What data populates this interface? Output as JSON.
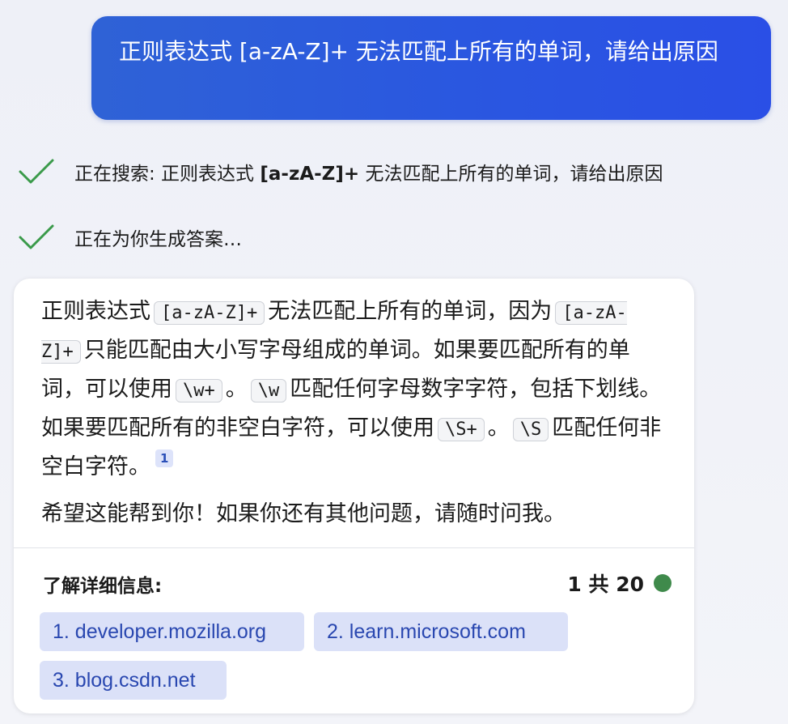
{
  "user_message": "正则表达式 [a-zA-Z]+ 无法匹配上所有的单词，请给出原因",
  "status": {
    "search_prefix": "正在搜索: 正则表达式 ",
    "search_bold": "[a-zA-Z]+",
    "search_suffix": " 无法匹配上所有的单词，请给出原因",
    "generating": "正在为你生成答案…"
  },
  "answer": {
    "t1": "正则表达式",
    "c1": "[a-zA-Z]+",
    "t2": "无法匹配上所有的单词，因为",
    "c2": "[a-zA-Z]+",
    "t3": "只能匹配由大小写字母组成的单词。如果要匹配所有的单词，可以使用",
    "c3": "\\w+",
    "t4": "。",
    "c4": "\\w",
    "t5": "匹配任何字母数字字符，包括下划线。如果要匹配所有的非空白字符，可以使用",
    "c5": "\\S+",
    "t6": "。",
    "c6": "\\S",
    "t7": "匹配任何非空白字符。",
    "citation": "1",
    "closing": "希望这能帮到你！如果你还有其他问题，请随时问我。"
  },
  "learn_more": {
    "label": "了解详细信息:",
    "counter": "1 共 20",
    "status_color": "#3f8a4b",
    "sources": [
      "1. developer.mozilla.org",
      "2. learn.microsoft.com",
      "3. blog.csdn.net"
    ]
  },
  "colors": {
    "user_bubble": "#2a57e0",
    "check": "#3a9a4a",
    "chip_bg": "#dbe1f8",
    "chip_text": "#2947b0"
  }
}
